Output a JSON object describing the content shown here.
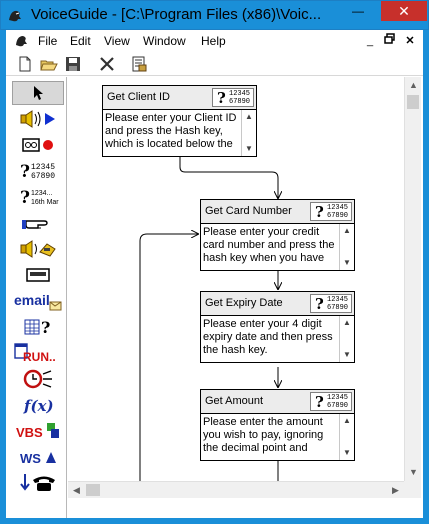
{
  "window": {
    "title": "VoiceGuide - [C:\\Program Files (x86)\\Voic...",
    "minimize_glyph": "—",
    "close_glyph": "✕"
  },
  "menu": {
    "items": [
      "File",
      "Edit",
      "View",
      "Window",
      "Help"
    ],
    "mdi_min": "_",
    "mdi_restore": "🗗",
    "mdi_close": "✕"
  },
  "toolbar": {
    "buttons": [
      "new-icon",
      "open-icon",
      "save-icon",
      "delete-icon",
      "properties-icon"
    ]
  },
  "palette": {
    "items": [
      {
        "name": "pointer-tool",
        "icon": "arrow-pointer-icon",
        "selected": true
      },
      {
        "name": "play-tool",
        "icon": "speaker-play-icon"
      },
      {
        "name": "record-tool",
        "icon": "tape-record-icon"
      },
      {
        "name": "get-numbers-tool",
        "icon": "question-numbers-icon",
        "numbers": "12345\n67890"
      },
      {
        "name": "say-date-tool",
        "icon": "date-icon",
        "numbers": "1234...\n16th Mar"
      },
      {
        "name": "transfer-tool",
        "icon": "hand-point-icon"
      },
      {
        "name": "voicemail-tool",
        "icon": "speaker-phone-icon"
      },
      {
        "name": "send-pager-tool",
        "icon": "pager-icon"
      },
      {
        "name": "email-tool",
        "icon": "email-icon",
        "label": "email"
      },
      {
        "name": "database-query-tool",
        "icon": "grid-question-icon"
      },
      {
        "name": "run-program-tool",
        "icon": "run-icon",
        "label": "RUN.."
      },
      {
        "name": "time-switch-tool",
        "icon": "clock-icon"
      },
      {
        "name": "evaluate-expression-tool",
        "icon": "function-icon",
        "label": "f(x)"
      },
      {
        "name": "vbs-tool",
        "icon": "vbs-icon",
        "label": "VBS"
      },
      {
        "name": "web-service-tool",
        "icon": "ws-icon",
        "label": "WS"
      },
      {
        "name": "make-call-tool",
        "icon": "outbound-phone-icon"
      }
    ]
  },
  "badge": {
    "q": "?",
    "digits": "12345\n67890"
  },
  "nodes": [
    {
      "title": "Get Client ID",
      "text": "Please enter your Client ID and press the Hash key, which is located below the"
    },
    {
      "title": "Get Card Number",
      "text": "Please enter your credit card number and press the hash key when you have"
    },
    {
      "title": "Get Expiry Date",
      "text": "Please enter your 4 digit expiry date and then press the hash key."
    },
    {
      "title": "Get Amount",
      "text": "Please enter the amount you wish to pay, ignoring the decimal point and press"
    }
  ],
  "colors": {
    "titlebar": "#1a8fd8",
    "close": "#c7302b",
    "node_header": "#ececec"
  }
}
